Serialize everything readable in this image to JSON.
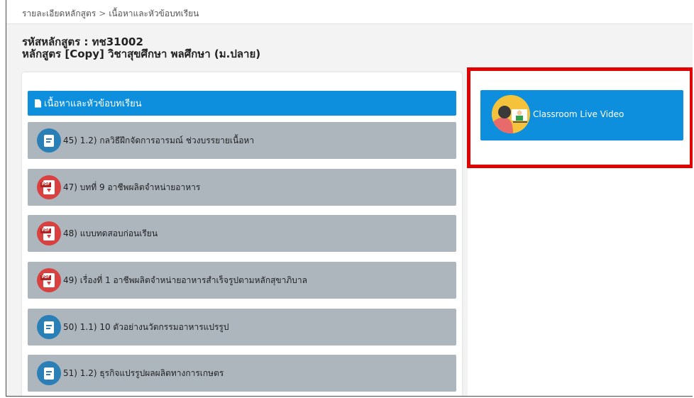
{
  "breadcrumb": {
    "parent": "รายละเอียดหลักสูตร",
    "separator": ">",
    "current": "เนื้อหาและหัวข้อบทเรียน"
  },
  "course": {
    "code_line": "รหัสหลักสูตร : ทช31002",
    "name_line": "หลักสูตร [Copy] วิชาสุขศึกษา พลศึกษา (ม.ปลาย)"
  },
  "section": {
    "title": "เนื้อหาและหัวข้อบทเรียน",
    "icon": "document-icon"
  },
  "lessons": [
    {
      "label": "45) 1.2) กลวิธีฝึกจัดการอารมณ์ ช่วงบรรยายเนื้อหา",
      "icon": "file-icon",
      "color": "#2a7fb6"
    },
    {
      "label": "47) บทที่ 9 อาชีพผลิตจำหน่ายอาหาร",
      "icon": "pdf-icon",
      "color": "#d94040"
    },
    {
      "label": "48) แบบทดสอบก่อนเรียน",
      "icon": "pdf-icon",
      "color": "#d94040"
    },
    {
      "label": "49) เรื่องที่ 1 อาชีพผลิตจำหน่ายอาหารสำเร็จรูปตามหลักสุขาภิบาล",
      "icon": "pdf-icon",
      "color": "#d94040"
    },
    {
      "label": "50) 1.1) 10 ตัวอย่างนวัตกรรมอาหารแปรรูป",
      "icon": "file-icon",
      "color": "#2a7fb6"
    },
    {
      "label": "51) 1.2) ธุรกิจแปรรูปผลผลิตทางการเกษตร",
      "icon": "file-icon",
      "color": "#2a7fb6"
    }
  ],
  "live": {
    "label": "Classroom Live Video",
    "icon": "teacher-avatar-icon"
  },
  "colors": {
    "accent": "#0d8fdd",
    "lesson_bg": "#adb5bd",
    "highlight": "#e00000"
  }
}
